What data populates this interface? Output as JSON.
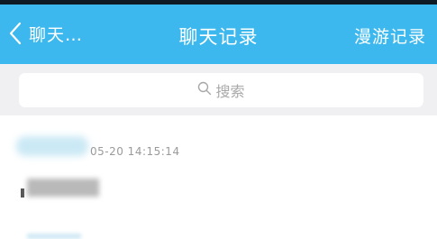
{
  "header": {
    "back_label": "聊天…",
    "title": "聊天记录",
    "roam_label": "漫游记录",
    "bar_color": "#3cb8ee"
  },
  "search": {
    "placeholder": "搜索"
  },
  "records": [
    {
      "time": "05-20 14:15:14"
    }
  ]
}
